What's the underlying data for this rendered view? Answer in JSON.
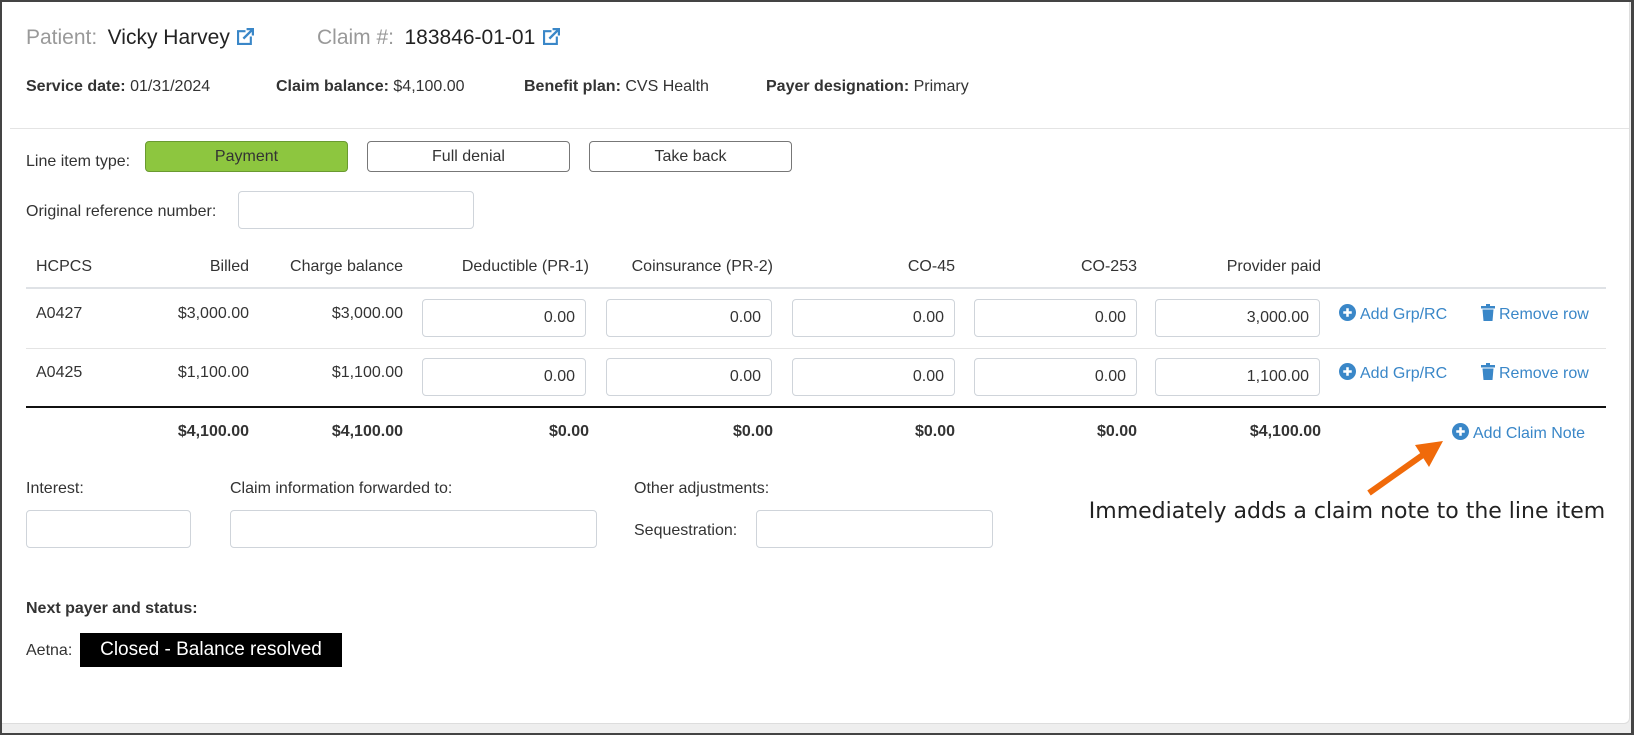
{
  "header": {
    "patient_label": "Patient:",
    "patient_name": "Vicky Harvey",
    "claim_label": "Claim #:",
    "claim_number": "183846-01-01"
  },
  "meta": {
    "service_date_label": "Service date:",
    "service_date": "01/31/2024",
    "claim_balance_label": "Claim balance:",
    "claim_balance": "$4,100.00",
    "benefit_plan_label": "Benefit plan:",
    "benefit_plan": "CVS Health",
    "payer_designation_label": "Payer designation:",
    "payer_designation": "Primary"
  },
  "line_item_type": {
    "label": "Line item type:",
    "options": [
      "Payment",
      "Full denial",
      "Take back"
    ],
    "selected": "Payment"
  },
  "reference": {
    "label": "Original reference number:",
    "value": ""
  },
  "table": {
    "headers": [
      "HCPCS",
      "Billed",
      "Charge balance",
      "Deductible (PR-1)",
      "Coinsurance (PR-2)",
      "CO-45",
      "CO-253",
      "Provider paid"
    ],
    "rows": [
      {
        "hcpcs": "A0427",
        "billed": "$3,000.00",
        "charge_balance": "$3,000.00",
        "deductible": "0.00",
        "coinsurance": "0.00",
        "co45": "0.00",
        "co253": "0.00",
        "provider_paid": "3,000.00",
        "add_label": "Add Grp/RC",
        "remove_label": "Remove row"
      },
      {
        "hcpcs": "A0425",
        "billed": "$1,100.00",
        "charge_balance": "$1,100.00",
        "deductible": "0.00",
        "coinsurance": "0.00",
        "co45": "0.00",
        "co253": "0.00",
        "provider_paid": "1,100.00",
        "add_label": "Add Grp/RC",
        "remove_label": "Remove row"
      }
    ],
    "totals": {
      "billed": "$4,100.00",
      "charge_balance": "$4,100.00",
      "deductible": "$0.00",
      "coinsurance": "$0.00",
      "co45": "$0.00",
      "co253": "$0.00",
      "provider_paid": "$4,100.00"
    },
    "add_claim_note_label": "Add Claim Note"
  },
  "extras": {
    "interest_label": "Interest:",
    "interest_value": "",
    "forwarded_label": "Claim information forwarded to:",
    "forwarded_value": "",
    "other_adjustments_label": "Other adjustments:",
    "sequestration_label": "Sequestration:",
    "sequestration_value": ""
  },
  "next_payer": {
    "label": "Next payer and status:",
    "payer": "Aetna:",
    "status": "Closed - Balance resolved"
  },
  "annotation": {
    "text": "Immediately adds a claim note to the line item"
  },
  "colors": {
    "accent_link": "#3a87c8",
    "active_segment": "#8dc63f",
    "annotation_arrow": "#f06a0a",
    "status_bg": "#000000"
  }
}
